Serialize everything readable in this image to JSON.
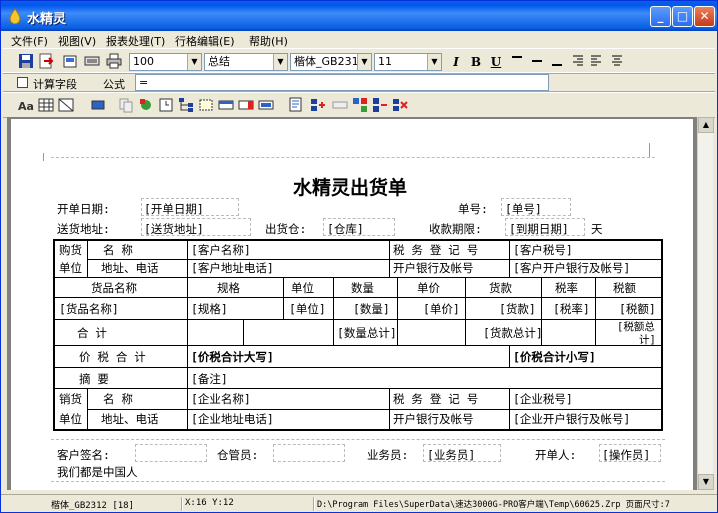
{
  "window": {
    "title": "水精灵"
  },
  "menu": [
    "文件(F)",
    "视图(V)",
    "报表处理(T)",
    "行格编辑(E)",
    "帮助(H)"
  ],
  "toolbar": {
    "zoom": "100",
    "page_mode": "总结",
    "font_name": "楷体_GB2312",
    "font_size": "11",
    "italic_label": "I",
    "bold_label": "B",
    "underline_label": "U"
  },
  "formula_bar": {
    "calc_field_label": "计算字段",
    "formula_label": "公式",
    "formula_value": "="
  },
  "form": {
    "title": "水精灵出货单",
    "header": {
      "start_date_label": "开单日期:",
      "start_date_value": "[开单日期]",
      "number_label": "单号:",
      "number_value": "[单号]",
      "ship_addr_label": "送货地址:",
      "ship_addr_value": "[送货地址]",
      "warehouse_label": "出货仓:",
      "warehouse_value": "[仓库]",
      "due_label": "收款期限:",
      "due_value": "[到期日期]",
      "due_unit": "天"
    },
    "buyer": {
      "tag1": "购货",
      "tag2": "单位",
      "name_label": "名        称",
      "name_value": "[客户名称]",
      "tax_label": "税 务 登 记 号",
      "tax_value": "[客户税号]",
      "addr_label": "地址、电话",
      "addr_value": "[客户地址电话]",
      "bank_label": "开户银行及帐号",
      "bank_value": "[客户开户银行及帐号]"
    },
    "columns": [
      "货品名称",
      "规格",
      "单位",
      "数量",
      "单价",
      "货款",
      "税率",
      "税额"
    ],
    "row": [
      "[货品名称]",
      "[规格]",
      "[单位]",
      "[数量]",
      "[单价]",
      "[货款]",
      "[税率]",
      "[税额]"
    ],
    "totals": {
      "label": "合        计",
      "qty": "[数量总计]",
      "amount": "[货款总计]",
      "tax1": "[税额总",
      "tax2": "计]"
    },
    "price_tax": {
      "label": "价 税 合 计",
      "upper": "[价税合计大写]",
      "lower": "[价税合计小写]"
    },
    "summary": {
      "label": "摘      要",
      "value": "[备注]"
    },
    "seller": {
      "tag1": "销货",
      "tag2": "单位",
      "name_label": "名        称",
      "name_value": "[企业名称]",
      "tax_label": "税 务 登 记 号",
      "tax_value": "[企业税号]",
      "addr_label": "地址、电话",
      "addr_value": "[企业地址电话]",
      "bank_label": "开户银行及帐号",
      "bank_value": "[企业开户银行及帐号]"
    },
    "footer": {
      "customer_sign": "客户签名:",
      "keeper": "仓管员:",
      "salesman_label": "业务员:",
      "salesman_value": "[业务员]",
      "creator_label": "开单人:",
      "creator_value": "[操作员]",
      "note": "我们都是中国人"
    }
  },
  "status": {
    "font": "楷体_GB2312 [18]",
    "coords": "X:16 Y:12",
    "path": "D:\\Program Files\\SuperData\\速达3000G-PRO客户端\\Temp\\60625.Zrp 页面尺寸:7"
  },
  "colors": {
    "titlebar": "#0a5fe3",
    "close": "#c43b1a",
    "face": "#ece9d8",
    "doc_bg": "#808080"
  }
}
